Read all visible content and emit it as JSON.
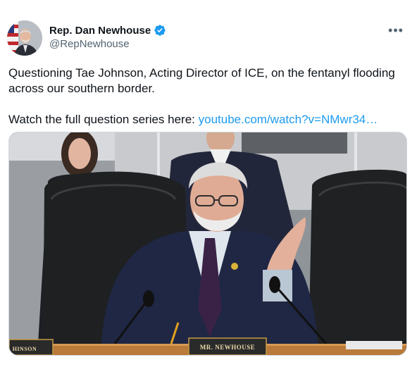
{
  "author": {
    "display_name": "Rep. Dan Newhouse",
    "handle": "@RepNewhouse",
    "verified_icon": "verified-badge-icon",
    "more_icon": "more-horizontal-icon"
  },
  "tweet": {
    "text_line1": "Questioning Tae Johnson, Acting Director of ICE, on the fentanyl flooding across our southern border.",
    "text_line2_prefix": "Watch the full question series here: ",
    "link_text": "youtube.com/watch?v=NMwr34…"
  },
  "media": {
    "nameplate_main": "MR. NEWHOUSE",
    "nameplate_left": "HINSON"
  },
  "colors": {
    "text": "#0f1419",
    "secondary": "#536471",
    "link": "#1d9bf0",
    "verified": "#1d9bf0"
  }
}
